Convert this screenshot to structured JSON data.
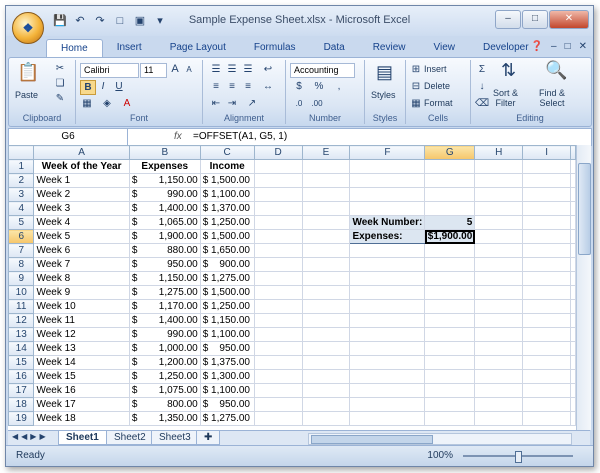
{
  "window": {
    "title": "Sample Expense Sheet.xlsx - Microsoft Excel"
  },
  "tabs": [
    "Home",
    "Insert",
    "Page Layout",
    "Formulas",
    "Data",
    "Review",
    "View",
    "Developer"
  ],
  "ribbon": {
    "clipboard": {
      "label": "Clipboard",
      "paste": "Paste"
    },
    "font": {
      "label": "Font",
      "name": "Calibri",
      "size": "11",
      "bold": "B",
      "italic": "I",
      "underline": "U",
      "grow": "A",
      "shrink": "A"
    },
    "alignment": {
      "label": "Alignment"
    },
    "number": {
      "label": "Number",
      "format": "Accounting",
      "currency": "$",
      "percent": "%"
    },
    "styles": {
      "label": "Styles",
      "button": "Styles"
    },
    "cells": {
      "label": "Cells",
      "insert": "Insert",
      "delete": "Delete",
      "format": "Format"
    },
    "editing": {
      "label": "Editing",
      "sort": "Sort &\nFilter",
      "find": "Find &\nSelect",
      "sigma": "Σ"
    }
  },
  "formula_bar": {
    "cell": "G6",
    "formula": "=OFFSET(A1, G5, 1)",
    "fx": "fx"
  },
  "columns": [
    "A",
    "B",
    "C",
    "D",
    "E",
    "F",
    "G",
    "H",
    "I"
  ],
  "headers": {
    "a": "Week of the Year",
    "b": "Expenses",
    "c": "Income"
  },
  "rows": [
    {
      "week": "Week 1",
      "exp": "1,150.00",
      "inc": "$ 1,500.00"
    },
    {
      "week": "Week 2",
      "exp": "990.00",
      "inc": "$ 1,100.00"
    },
    {
      "week": "Week 3",
      "exp": "1,400.00",
      "inc": "$ 1,370.00"
    },
    {
      "week": "Week 4",
      "exp": "1,065.00",
      "inc": "$ 1,250.00"
    },
    {
      "week": "Week 5",
      "exp": "1,900.00",
      "inc": "$ 1,500.00"
    },
    {
      "week": "Week 6",
      "exp": "880.00",
      "inc": "$ 1,650.00"
    },
    {
      "week": "Week 7",
      "exp": "950.00",
      "inc": "$    900.00"
    },
    {
      "week": "Week 8",
      "exp": "1,150.00",
      "inc": "$ 1,275.00"
    },
    {
      "week": "Week 9",
      "exp": "1,275.00",
      "inc": "$ 1,500.00"
    },
    {
      "week": "Week 10",
      "exp": "1,170.00",
      "inc": "$ 1,250.00"
    },
    {
      "week": "Week 11",
      "exp": "1,400.00",
      "inc": "$ 1,150.00"
    },
    {
      "week": "Week 12",
      "exp": "990.00",
      "inc": "$ 1,100.00"
    },
    {
      "week": "Week 13",
      "exp": "1,000.00",
      "inc": "$    950.00"
    },
    {
      "week": "Week 14",
      "exp": "1,200.00",
      "inc": "$ 1,375.00"
    },
    {
      "week": "Week 15",
      "exp": "1,250.00",
      "inc": "$ 1,300.00"
    },
    {
      "week": "Week 16",
      "exp": "1,075.00",
      "inc": "$ 1,100.00"
    },
    {
      "week": "Week 17",
      "exp": "800.00",
      "inc": "$    950.00"
    },
    {
      "week": "Week 18",
      "exp": "1,350.00",
      "inc": "$ 1,275.00"
    }
  ],
  "dollar": "$",
  "lookup": {
    "week_label": "Week Number:",
    "week_value": "5",
    "exp_label": "Expenses:",
    "exp_value": "$1,900.00"
  },
  "sheets": [
    "Sheet1",
    "Sheet2",
    "Sheet3"
  ],
  "status": {
    "ready": "Ready",
    "zoom": "100%"
  }
}
